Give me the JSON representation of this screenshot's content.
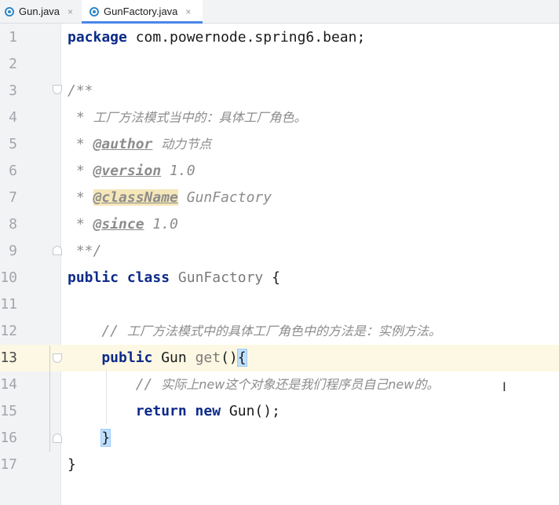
{
  "tabs": [
    {
      "label": "Gun.java",
      "close": "×"
    },
    {
      "label": "GunFactory.java",
      "close": "×"
    }
  ],
  "lines": [
    {
      "n": "1",
      "parts": [
        [
          "kw",
          "package"
        ],
        [
          "plain",
          " com.powernode.spring6.bean;"
        ]
      ]
    },
    {
      "n": "2",
      "parts": []
    },
    {
      "n": "3",
      "parts": [
        [
          "cmt",
          "/**"
        ]
      ]
    },
    {
      "n": "4",
      "parts": [
        [
          "cmt",
          " * "
        ],
        [
          "cn",
          "工厂方法模式当中的：具体工厂角色。"
        ]
      ]
    },
    {
      "n": "5",
      "parts": [
        [
          "cmt",
          " * "
        ],
        [
          "tag",
          "@author"
        ],
        [
          "cmt",
          " "
        ],
        [
          "cn",
          "动力节点"
        ]
      ]
    },
    {
      "n": "6",
      "parts": [
        [
          "cmt",
          " * "
        ],
        [
          "tag",
          "@version"
        ],
        [
          "cmt",
          " 1.0"
        ]
      ]
    },
    {
      "n": "7",
      "parts": [
        [
          "cmt",
          " * "
        ],
        [
          "tagbox",
          "@className"
        ],
        [
          "cmt",
          " GunFactory"
        ]
      ]
    },
    {
      "n": "8",
      "parts": [
        [
          "cmt",
          " * "
        ],
        [
          "tag",
          "@since"
        ],
        [
          "cmt",
          " 1.0"
        ]
      ]
    },
    {
      "n": "9",
      "parts": [
        [
          "cmt",
          " **/"
        ]
      ]
    },
    {
      "n": "10",
      "parts": [
        [
          "kw",
          "public class "
        ],
        [
          "cls",
          "GunFactory"
        ],
        [
          "plain",
          " {"
        ]
      ]
    },
    {
      "n": "11",
      "parts": []
    },
    {
      "n": "12",
      "parts": [
        [
          "cmt",
          "    // "
        ],
        [
          "cn",
          "工厂方法模式中的具体工厂角色中的方法是：实例方法。"
        ]
      ]
    },
    {
      "n": "13",
      "parts": [
        [
          "kw",
          "    public "
        ],
        [
          "plain",
          "Gun "
        ],
        [
          "meth",
          "get"
        ],
        [
          "plain",
          "()"
        ],
        [
          "brace",
          "{"
        ]
      ]
    },
    {
      "n": "14",
      "parts": [
        [
          "cmt",
          "        // "
        ],
        [
          "cn",
          "实际上new这个对象还是我们程序员自己new的。"
        ]
      ]
    },
    {
      "n": "15",
      "parts": [
        [
          "kw",
          "        return new "
        ],
        [
          "plain",
          "Gun();"
        ]
      ]
    },
    {
      "n": "16",
      "parts": [
        [
          "brace",
          "    }"
        ]
      ]
    },
    {
      "n": "17",
      "parts": [
        [
          "plain",
          "}"
        ]
      ]
    }
  ],
  "current_line": "13",
  "cursor_glyph": "I"
}
